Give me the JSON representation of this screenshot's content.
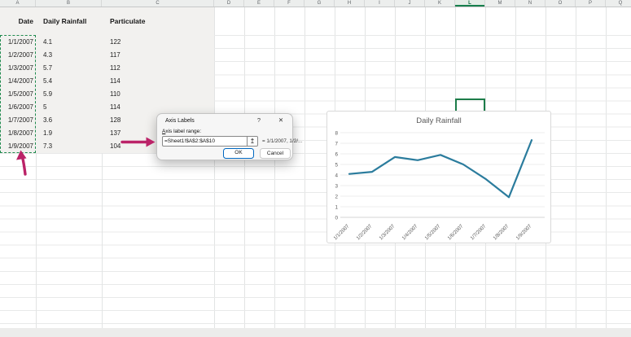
{
  "sheet": {
    "columns": [
      "A",
      "B",
      "C",
      "D",
      "E",
      "F",
      "G",
      "H",
      "I",
      "J",
      "K",
      "L",
      "M",
      "N",
      "O",
      "P",
      "Q"
    ],
    "selected_column": "L",
    "table": {
      "headers": [
        "Date",
        "Daily Rainfall",
        "Particulate"
      ],
      "rows": [
        [
          "1/1/2007",
          "4.1",
          "122"
        ],
        [
          "1/2/2007",
          "4.3",
          "117"
        ],
        [
          "1/3/2007",
          "5.7",
          "112"
        ],
        [
          "1/4/2007",
          "5.4",
          "114"
        ],
        [
          "1/5/2007",
          "5.9",
          "110"
        ],
        [
          "1/6/2007",
          "5",
          "114"
        ],
        [
          "1/7/2007",
          "3.6",
          "128"
        ],
        [
          "1/8/2007",
          "1.9",
          "137"
        ],
        [
          "1/9/2007",
          "7.3",
          "104"
        ]
      ]
    }
  },
  "dialog": {
    "title": "Axis Labels",
    "help_icon": "?",
    "close_icon": "✕",
    "field_label": "Axis label range:",
    "field_value": "=Sheet1!$A$2:$A$10",
    "picker_icon": "↥",
    "preview_text": "= 1/1/2007, 1/2/...",
    "ok_label": "OK",
    "cancel_label": "Cancel"
  },
  "chart_data": {
    "type": "line",
    "title": "Daily Rainfall",
    "x": [
      "1/1/2007",
      "1/2/2007",
      "1/3/2007",
      "1/4/2007",
      "1/5/2007",
      "1/6/2007",
      "1/7/2007",
      "1/8/2007",
      "1/9/2007"
    ],
    "series": [
      {
        "name": "Daily Rainfall",
        "values": [
          4.1,
          4.3,
          5.7,
          5.4,
          5.9,
          5,
          3.6,
          1.9,
          7.3
        ]
      }
    ],
    "ylim": [
      0,
      8
    ],
    "ytick_step": 1,
    "grid": true,
    "legend": false,
    "line_color": "#2b7c9d",
    "text_color": "#595959"
  },
  "colors": {
    "excel_green": "#1f8a4e",
    "annotation_pink": "#bb2368",
    "ok_accent": "#0067c0"
  }
}
